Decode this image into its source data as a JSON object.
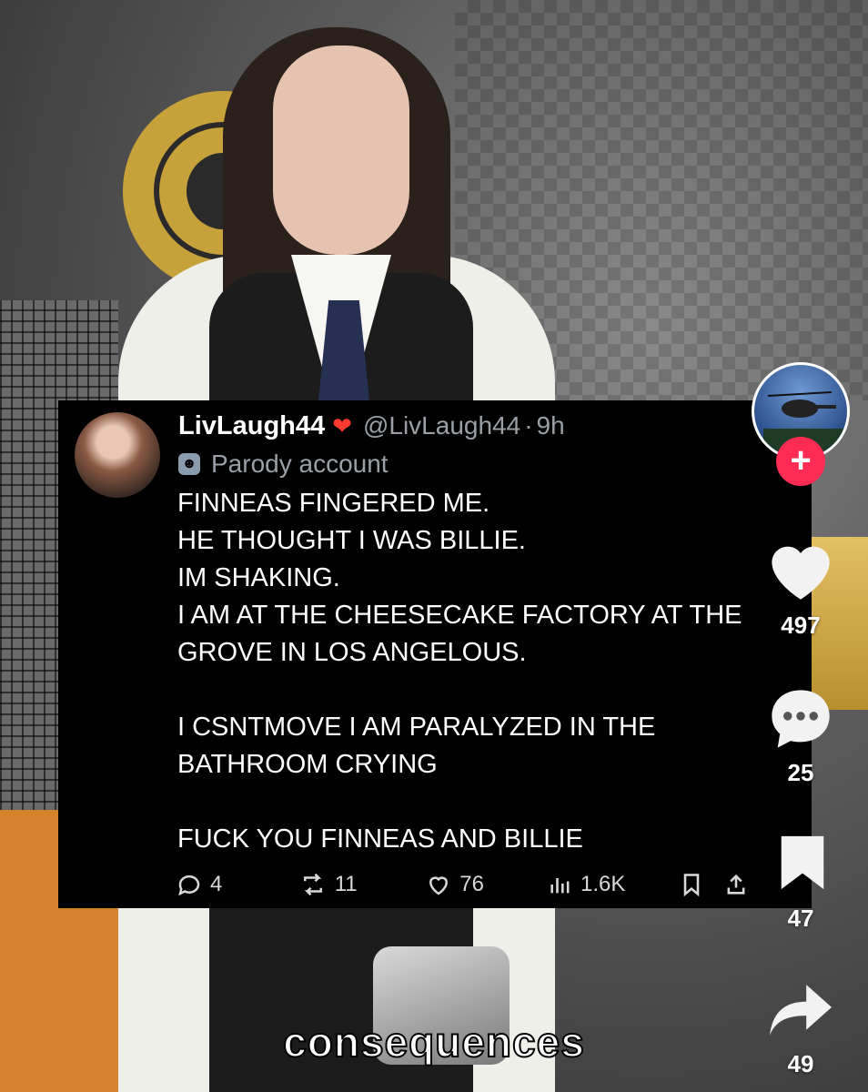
{
  "tweet": {
    "display_name": "LivLaugh44",
    "name_emoji": "❤",
    "handle": "@LivLaugh44",
    "time": "9h",
    "parody_label": "Parody account",
    "lines": [
      "FINNEAS FINGERED ME.",
      "HE THOUGHT I WAS BILLIE.",
      "IM SHAKING.",
      "I AM AT THE CHEESECAKE FACTORY AT THE",
      "GROVE IN LOS ANGELOUS.",
      "",
      "I CSNTMOVE I AM PARALYZED IN THE",
      "BATHROOM CRYING",
      "",
      "FUCK YOU FINNEAS AND BILLIE"
    ],
    "replies": "4",
    "reposts": "11",
    "likes": "76",
    "views": "1.6K"
  },
  "rail": {
    "likes": "497",
    "comments": "25",
    "saves": "47",
    "shares": "49",
    "follow_symbol": "+"
  },
  "caption": "consequences",
  "colors": {
    "follow": "#fe2c55",
    "tweet_bg": "#000000",
    "muted_text": "#9aa0a6"
  },
  "icons": [
    "reply-icon",
    "repost-icon",
    "like-icon",
    "views-icon",
    "bookmark-icon",
    "share-icon",
    "heart-icon",
    "comment-icon",
    "save-icon",
    "forward-icon",
    "mask-icon"
  ]
}
